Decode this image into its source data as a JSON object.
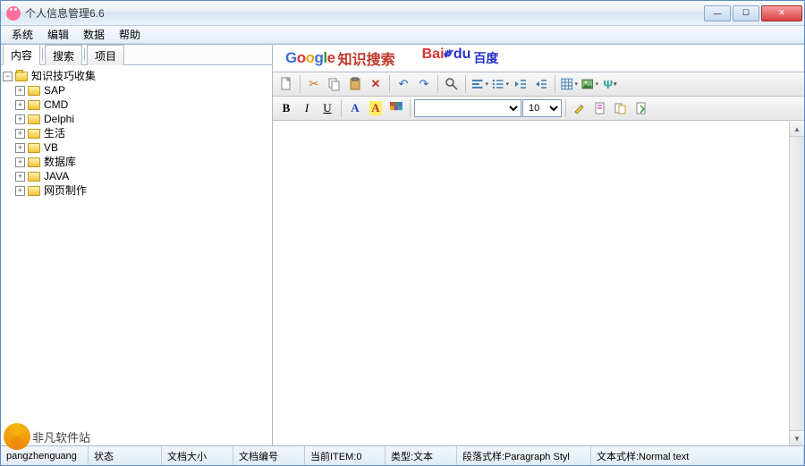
{
  "window": {
    "title": "个人信息管理6.6"
  },
  "menu": {
    "items": [
      "系统",
      "编辑",
      "数据",
      "帮助"
    ]
  },
  "left_tabs": {
    "items": [
      "内容",
      "搜索",
      "项目"
    ],
    "active_index": 0
  },
  "tree": {
    "root": {
      "label": "知识技巧收集",
      "expanded": true
    },
    "children": [
      {
        "label": "SAP"
      },
      {
        "label": "CMD"
      },
      {
        "label": "Delphi"
      },
      {
        "label": "生活"
      },
      {
        "label": "VB"
      },
      {
        "label": "数据库"
      },
      {
        "label": "JAVA"
      },
      {
        "label": "网页制作"
      }
    ]
  },
  "search_links": {
    "google_suffix": "知识搜索",
    "baidu_cn": "百度"
  },
  "toolbar2": {
    "font_value": "",
    "size_value": "10"
  },
  "statusbar": {
    "user": "pangzhenguang",
    "cells": [
      "状态",
      "文档大小",
      "文档编号",
      "当前ITEM:0",
      "类型:文本",
      "段落式样:Paragraph Styl",
      "文本式样:Normal text"
    ]
  },
  "footer": {
    "site": "非凡软件站"
  }
}
